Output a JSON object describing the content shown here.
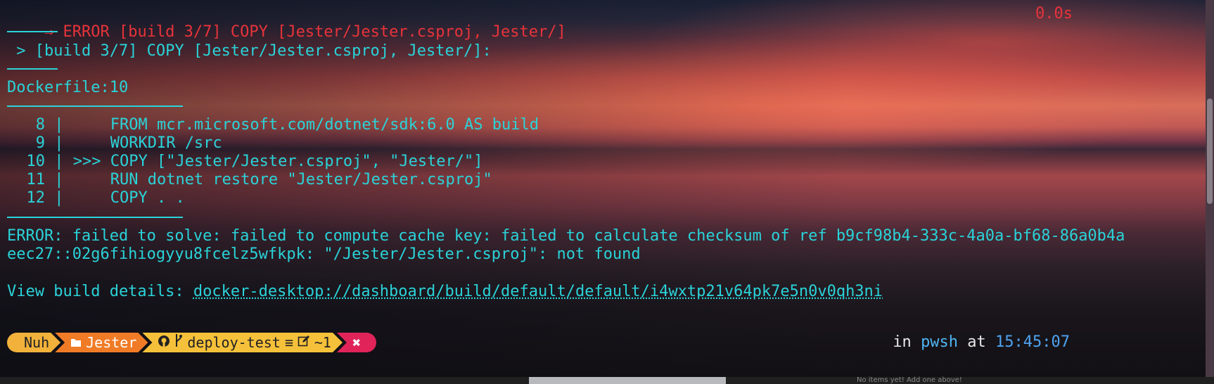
{
  "error_header": {
    "arrow": "⇒",
    "text": "ERROR [build 3/7] COPY [Jester/Jester.csproj, Jester/]",
    "time": "0.0s"
  },
  "step_line": " > [build 3/7] COPY [Jester/Jester.csproj, Jester/]:",
  "dockerfile_ref": "Dockerfile:10",
  "source_lines": [
    {
      "num": "8",
      "sep": " |",
      "marker": "    ",
      "code": " FROM mcr.microsoft.com/dotnet/sdk:6.0 AS build"
    },
    {
      "num": "9",
      "sep": " |",
      "marker": "    ",
      "code": " WORKDIR /src"
    },
    {
      "num": "10",
      "sep": " |",
      "marker": " >>>",
      "code": " COPY [\"Jester/Jester.csproj\", \"Jester/\"]"
    },
    {
      "num": "11",
      "sep": " |",
      "marker": "    ",
      "code": " RUN dotnet restore \"Jester/Jester.csproj\""
    },
    {
      "num": "12",
      "sep": " |",
      "marker": "    ",
      "code": " COPY . ."
    }
  ],
  "error_message": {
    "line1": "ERROR: failed to solve: failed to compute cache key: failed to calculate checksum of ref b9cf98b4-333c-4a0a-bf68-86a0b4a",
    "line2": "eec27::02g6fihiogyyu8fcelz5wfkpk: \"/Jester/Jester.csproj\": not found"
  },
  "build_details": {
    "label": "View build details: ",
    "link": "docker-desktop://dashboard/build/default/default/i4wxtp21v64pk7e5n0v0qh3ni"
  },
  "prompt": {
    "user": "Nuh",
    "path": "Jester",
    "branch": "deploy-test",
    "git_status": "≡",
    "changes": "~1",
    "error_mark": "✖",
    "colors": {
      "user": "#f2b13a",
      "path": "#f07b26",
      "git": "#f6c13a",
      "error": "#e0245a"
    }
  },
  "right_prompt": {
    "in": "in ",
    "shell": "pwsh",
    "at": " at ",
    "time": "15:45:07"
  },
  "bottom_note": "No items yet! Add one above!",
  "icons": [
    "folder-icon",
    "github-icon",
    "branch-icon",
    "edit-icon"
  ]
}
